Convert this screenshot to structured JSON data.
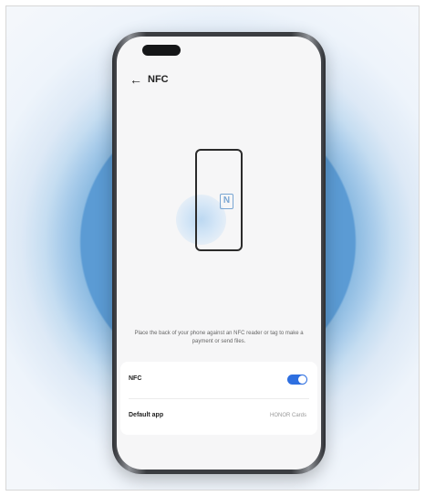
{
  "header": {
    "back_icon": "arrow-left-icon",
    "title": "NFC"
  },
  "illustration": {
    "nfc_icon": "nfc-icon",
    "nfc_logo_text": "N",
    "accent_color": "#5b9bd4"
  },
  "description": "Place the back of your phone against an NFC reader or tag to make a payment or send files.",
  "settings": {
    "nfc": {
      "label": "NFC",
      "enabled": true,
      "toggle_color": "#2e6fe0"
    },
    "default_app": {
      "label": "Default app",
      "value": "HONOR Cards"
    }
  }
}
